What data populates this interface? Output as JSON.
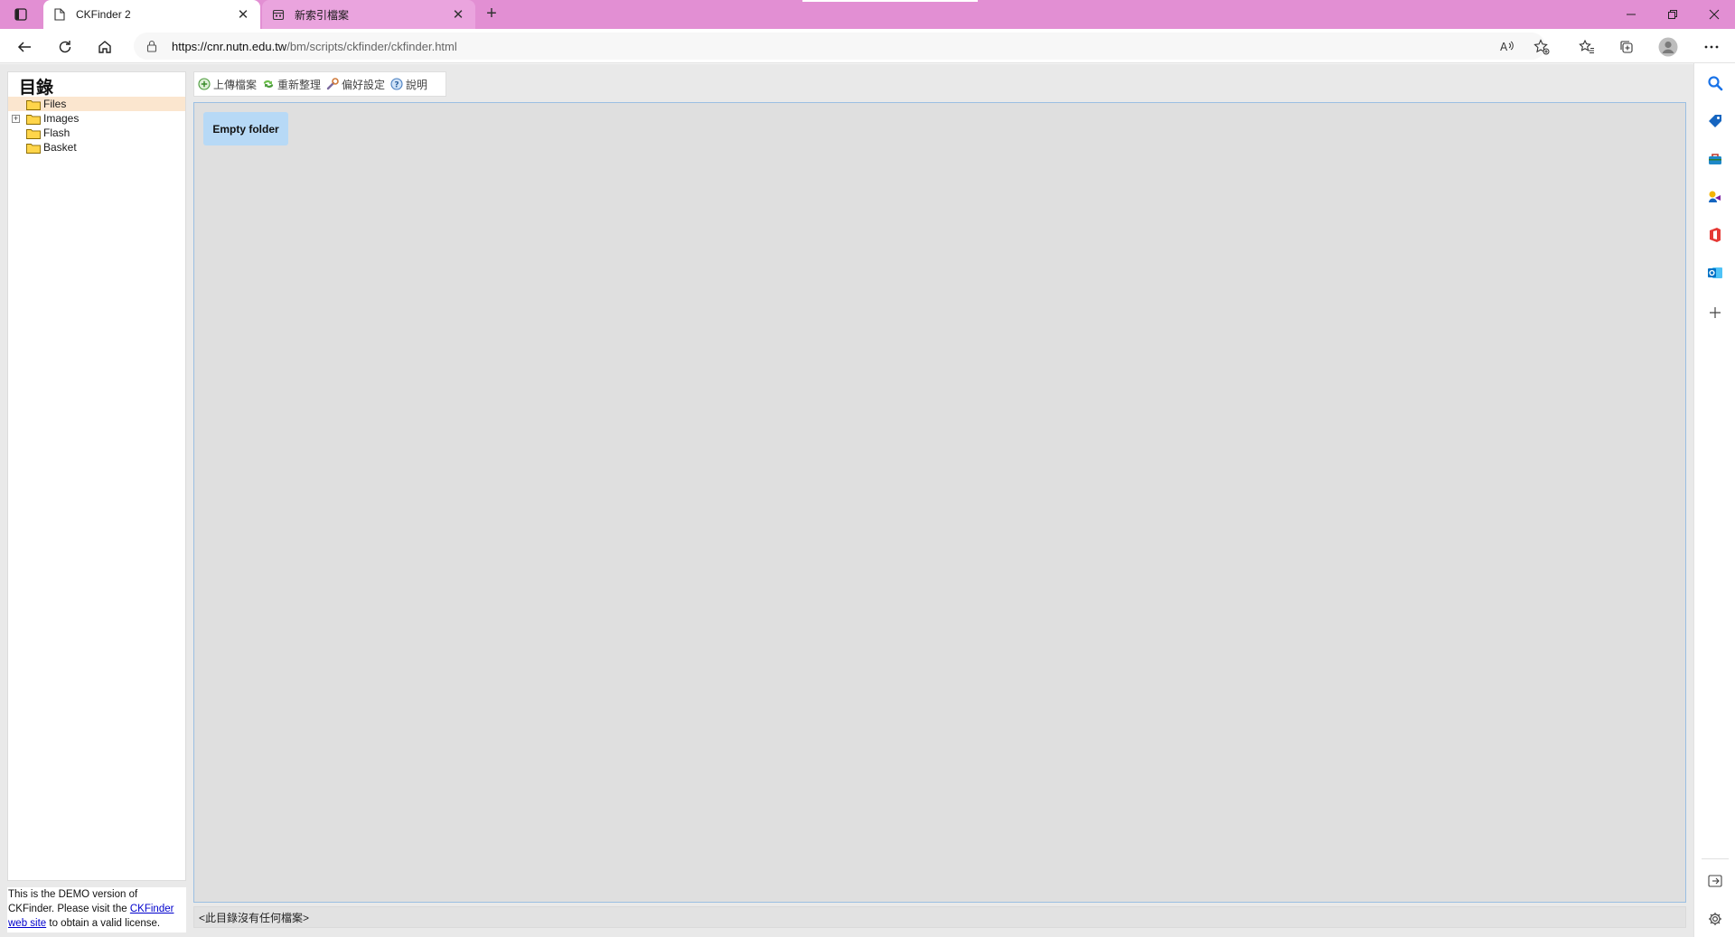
{
  "browser": {
    "tabs": [
      {
        "title": "CKFinder 2",
        "active": true,
        "icon": "page-icon"
      },
      {
        "title": "新索引檔案",
        "active": false,
        "icon": "calendar-icon"
      }
    ],
    "url_host": "https://cnr.nutn.edu.tw",
    "url_path": "/bm/scripts/ckfinder/ckfinder.html",
    "accent": "#e28fd3"
  },
  "finder": {
    "folders_title": "目錄",
    "folders": [
      {
        "label": "Files",
        "selected": true,
        "expandable": false
      },
      {
        "label": "Images",
        "selected": false,
        "expandable": true
      },
      {
        "label": "Flash",
        "selected": false,
        "expandable": false
      },
      {
        "label": "Basket",
        "selected": false,
        "expandable": false
      }
    ],
    "toolbar": {
      "upload": "上傳檔案",
      "refresh": "重新整理",
      "settings": "偏好設定",
      "help": "說明"
    },
    "empty_folder": "Empty folder",
    "status": "<此目錄沒有任何檔案>",
    "demo": {
      "text1": "This is the DEMO version of CKFinder. Please visit the ",
      "link": "CKFinder web site",
      "text2": " to obtain a valid license."
    }
  }
}
